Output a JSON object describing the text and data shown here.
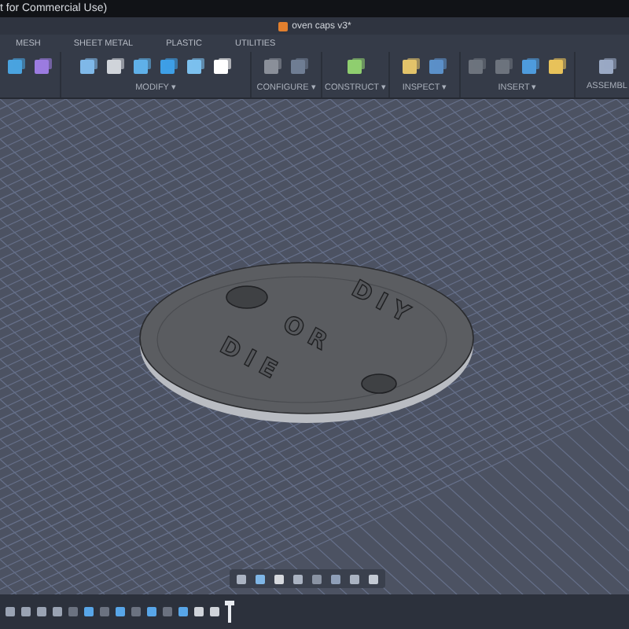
{
  "window": {
    "title": "t for Commercial Use)"
  },
  "document_tab": {
    "title": "oven caps v3*"
  },
  "toolbar": {
    "tabs": [
      "MESH",
      "SHEET METAL",
      "PLASTIC",
      "UTILITIES"
    ],
    "groups": [
      {
        "label": "MODIFY ▾"
      },
      {
        "label": "CONFIGURE ▾"
      },
      {
        "label": "CONSTRUCT ▾"
      },
      {
        "label": "INSPECT ▾"
      },
      {
        "label": "INSERT ▾"
      },
      {
        "label": "ASSEMBL"
      }
    ]
  },
  "model": {
    "engraving": [
      "DIY",
      "OR",
      "DIE"
    ]
  }
}
